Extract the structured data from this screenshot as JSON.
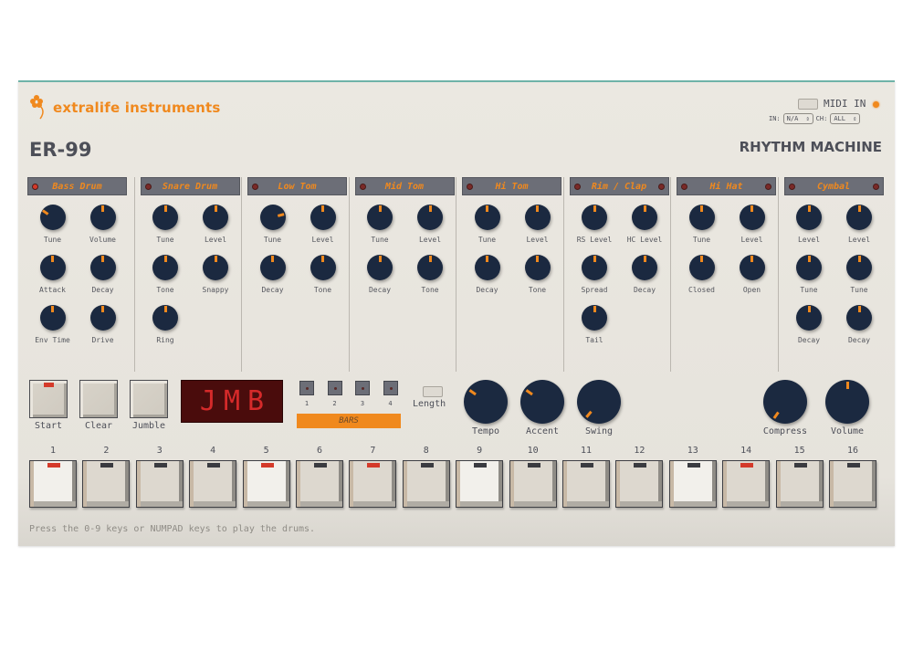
{
  "header": {
    "brand": "extralife instruments",
    "model": "ER-99",
    "subtitle": "RHYTHM MACHINE",
    "midi": {
      "label": "MIDI IN",
      "in_label": "IN:",
      "in_value": "N/A",
      "ch_label": "CH:",
      "ch_value": "ALL",
      "led_color": "#f0891e"
    }
  },
  "colors": {
    "accent": "#f0891e",
    "knob": "#1b2940",
    "panel": "#e8e5de",
    "led_on": "#d43a2a",
    "display_bg": "#4a0c0c"
  },
  "strips": [
    {
      "name": "Bass Drum",
      "leds": [
        "left-on"
      ],
      "knobs": [
        {
          "label": "Tune",
          "angle": -55
        },
        {
          "label": "Volume",
          "angle": 0
        },
        {
          "label": "Attack",
          "angle": 0
        },
        {
          "label": "Decay",
          "angle": 0
        },
        {
          "label": "Env Time",
          "angle": 0
        },
        {
          "label": "Drive",
          "angle": 0
        }
      ]
    },
    {
      "name": "Snare Drum",
      "leds": [
        "left"
      ],
      "knobs": [
        {
          "label": "Tune",
          "angle": 0
        },
        {
          "label": "Level",
          "angle": 0
        },
        {
          "label": "Tone",
          "angle": 0
        },
        {
          "label": "Snappy",
          "angle": 0
        },
        {
          "label": "Ring",
          "angle": 0
        }
      ]
    },
    {
      "name": "Low Tom",
      "leds": [
        "left"
      ],
      "knobs": [
        {
          "label": "Tune",
          "angle": 75
        },
        {
          "label": "Level",
          "angle": 0
        },
        {
          "label": "Decay",
          "angle": 0
        },
        {
          "label": "Tone",
          "angle": 0
        }
      ]
    },
    {
      "name": "Mid Tom",
      "leds": [
        "left"
      ],
      "knobs": [
        {
          "label": "Tune",
          "angle": 0
        },
        {
          "label": "Level",
          "angle": 0
        },
        {
          "label": "Decay",
          "angle": 0
        },
        {
          "label": "Tone",
          "angle": 0
        }
      ]
    },
    {
      "name": "Hi Tom",
      "leds": [
        "left"
      ],
      "knobs": [
        {
          "label": "Tune",
          "angle": 0
        },
        {
          "label": "Level",
          "angle": 0
        },
        {
          "label": "Decay",
          "angle": 0
        },
        {
          "label": "Tone",
          "angle": 0
        }
      ]
    },
    {
      "name": "Rim / Clap",
      "leds": [
        "left",
        "right"
      ],
      "knobs": [
        {
          "label": "RS Level",
          "angle": 0
        },
        {
          "label": "HC Level",
          "angle": 0
        },
        {
          "label": "Spread",
          "angle": 0
        },
        {
          "label": "Decay",
          "angle": 0
        },
        {
          "label": "Tail",
          "angle": 0
        }
      ]
    },
    {
      "name": "Hi Hat",
      "leds": [
        "left",
        "right"
      ],
      "knobs": [
        {
          "label": "Tune",
          "angle": 0
        },
        {
          "label": "Level",
          "angle": 0
        },
        {
          "label": "Closed",
          "angle": 0
        },
        {
          "label": "Open",
          "angle": 0
        }
      ]
    },
    {
      "name": "Cymbal",
      "leds": [
        "left",
        "right"
      ],
      "knobs": [
        {
          "label": "Level",
          "angle": 0
        },
        {
          "label": "Level",
          "angle": 0
        },
        {
          "label": "Tune",
          "angle": 0
        },
        {
          "label": "Tune",
          "angle": 0
        },
        {
          "label": "Decay",
          "angle": 0
        },
        {
          "label": "Decay",
          "angle": 0
        }
      ]
    }
  ],
  "controls": {
    "start_label": "Start",
    "start_active": true,
    "clear_label": "Clear",
    "jumble_label": "Jumble",
    "display_text": "JMB",
    "bars": [
      "1",
      "2",
      "3",
      "4"
    ],
    "bars_label": "BARS",
    "length_label": "Length",
    "knobs": [
      {
        "label": "Tempo",
        "angle": -55
      },
      {
        "label": "Accent",
        "angle": -55
      },
      {
        "label": "Swing",
        "angle": -140
      },
      {
        "label": "Compress",
        "angle": -145
      },
      {
        "label": "Volume",
        "angle": 0
      }
    ]
  },
  "steps": [
    {
      "num": "1",
      "lit": true,
      "led": true
    },
    {
      "num": "2",
      "lit": false,
      "led": false
    },
    {
      "num": "3",
      "lit": false,
      "led": false
    },
    {
      "num": "4",
      "lit": false,
      "led": false
    },
    {
      "num": "5",
      "lit": true,
      "led": true
    },
    {
      "num": "6",
      "lit": false,
      "led": false
    },
    {
      "num": "7",
      "lit": false,
      "led": true
    },
    {
      "num": "8",
      "lit": false,
      "led": false
    },
    {
      "num": "9",
      "lit": true,
      "led": false
    },
    {
      "num": "10",
      "lit": false,
      "led": false
    },
    {
      "num": "11",
      "lit": false,
      "led": false
    },
    {
      "num": "12",
      "lit": false,
      "led": false
    },
    {
      "num": "13",
      "lit": true,
      "led": false
    },
    {
      "num": "14",
      "lit": false,
      "led": true
    },
    {
      "num": "15",
      "lit": false,
      "led": false
    },
    {
      "num": "16",
      "lit": false,
      "led": false
    }
  ],
  "hint": "Press the 0-9 keys or NUMPAD keys to play the drums."
}
